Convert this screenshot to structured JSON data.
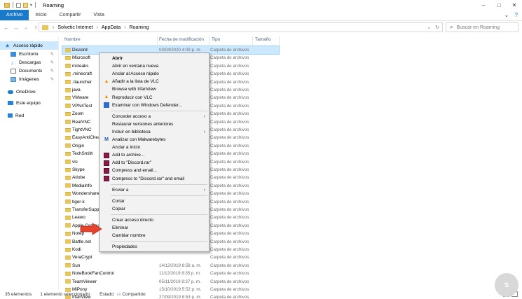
{
  "window": {
    "title": "Roaming",
    "controls": [
      "–",
      "□",
      "✕"
    ]
  },
  "ribbon": {
    "tabs": [
      "Archivo",
      "Inicio",
      "Compartir",
      "Vista"
    ],
    "expand": "⌄",
    "help": "?"
  },
  "address": {
    "segments": [
      "Solvetic Internet",
      "AppData",
      "Roaming"
    ],
    "search_placeholder": "Buscar en Roaming"
  },
  "nav": {
    "items": [
      {
        "label": "Acceso rápido",
        "icon": "star-icon",
        "selected": true,
        "pinned": false
      },
      {
        "label": "Escritorio",
        "icon": "desktop-icon",
        "selected": false,
        "pinned": true
      },
      {
        "label": "Descargas",
        "icon": "download-icon",
        "selected": false,
        "pinned": true
      },
      {
        "label": "Documents",
        "icon": "document-icon",
        "selected": false,
        "pinned": true
      },
      {
        "label": "Imágenes",
        "icon": "pictures-icon",
        "selected": false,
        "pinned": true
      },
      {
        "label": "OneDrive",
        "icon": "cloud-icon",
        "selected": false,
        "pinned": false
      },
      {
        "label": "Este equipo",
        "icon": "computer-icon",
        "selected": false,
        "pinned": false
      },
      {
        "label": "Red",
        "icon": "network-icon",
        "selected": false,
        "pinned": false
      }
    ]
  },
  "columns": {
    "name": "Nombre",
    "date": "Fecha de modificación",
    "type": "Tipo",
    "size": "Tamaño"
  },
  "files": [
    {
      "name": "Discord",
      "date": "03/04/2020 4:09 p. m.",
      "type": "Carpeta de archivos",
      "selected": true
    },
    {
      "name": "Microsoft",
      "date": "",
      "type": "Carpeta de archivos"
    },
    {
      "name": "mcleaks",
      "date": "",
      "type": "Carpeta de archivos"
    },
    {
      "name": ".minecraft",
      "date": "",
      "type": "Carpeta de archivos"
    },
    {
      "name": ".tlauncher",
      "date": "",
      "type": "Carpeta de archivos"
    },
    {
      "name": "java",
      "date": "",
      "type": "Carpeta de archivos"
    },
    {
      "name": "VMware",
      "date": "",
      "type": "Carpeta de archivos"
    },
    {
      "name": "VPN4Test",
      "date": "",
      "type": "Carpeta de archivos"
    },
    {
      "name": "Zoom",
      "date": "",
      "type": "Carpeta de archivos"
    },
    {
      "name": "RealVNC",
      "date": "",
      "type": "Carpeta de archivos"
    },
    {
      "name": "TightVNC",
      "date": "",
      "type": "Carpeta de archivos"
    },
    {
      "name": "EasyAntiCheat",
      "date": "",
      "type": "Carpeta de archivos"
    },
    {
      "name": "Origin",
      "date": "",
      "type": "Carpeta de archivos"
    },
    {
      "name": "TechSmith",
      "date": "",
      "type": "Carpeta de archivos"
    },
    {
      "name": "vlc",
      "date": "",
      "type": "Carpeta de archivos"
    },
    {
      "name": "Skype",
      "date": "",
      "type": "Carpeta de archivos"
    },
    {
      "name": "Adobe",
      "date": "",
      "type": "Carpeta de archivos"
    },
    {
      "name": "MediaInfo",
      "date": "",
      "type": "Carpeta de archivos"
    },
    {
      "name": "Wondershare",
      "date": "",
      "type": "Carpeta de archivos"
    },
    {
      "name": "tiger-k",
      "date": "",
      "type": "Carpeta de archivos"
    },
    {
      "name": "TransferSuppo",
      "date": "",
      "type": "Carpeta de archivos"
    },
    {
      "name": "Leawo",
      "date": "",
      "type": "Carpeta de archivos"
    },
    {
      "name": "Apple Compu",
      "date": "",
      "type": "Carpeta de archivos"
    },
    {
      "name": "Notep",
      "date": "",
      "type": "Carpeta de archivos"
    },
    {
      "name": "Battle.net",
      "date": "",
      "type": "Carpeta de archivos"
    },
    {
      "name": "Kodi",
      "date": "",
      "type": "Carpeta de archivos"
    },
    {
      "name": "VeraCrypt",
      "date": "",
      "type": "Carpeta de archivos"
    },
    {
      "name": "Sun",
      "date": "14/12/2019 8:58 a. m.",
      "type": "Carpeta de archivos"
    },
    {
      "name": "NoteBookFanControl",
      "date": "11/12/2019 8:35 p. m.",
      "type": "Carpeta de archivos"
    },
    {
      "name": "TeamViewer",
      "date": "05/11/2019 8:37 p. m.",
      "type": "Carpeta de archivos"
    },
    {
      "name": "MiPony",
      "date": "15/10/2019 5:52 p. m.",
      "type": "Carpeta de archivos"
    },
    {
      "name": "IrfanView",
      "date": "27/09/2019 8:53 p. m.",
      "type": "Carpeta de archivos"
    }
  ],
  "menu": [
    {
      "label": "Abrir",
      "bold": true,
      "icon": "",
      "sub": false,
      "sep_after": false
    },
    {
      "label": "Abrir en ventana nueva",
      "icon": "",
      "sub": false
    },
    {
      "label": "Anclar al Acceso rápido",
      "icon": "",
      "sub": false
    },
    {
      "label": "Añadir a la lista de VLC",
      "icon": "vlc-icon",
      "sub": false
    },
    {
      "label": "Browse with IrfanView",
      "icon": "",
      "sub": false
    },
    {
      "label": "Reproducir con VLC",
      "icon": "vlc-icon",
      "sub": false
    },
    {
      "label": "Examinar con Windows Defender...",
      "icon": "defender-icon",
      "sub": false,
      "sep_after": true
    },
    {
      "label": "Conceder acceso a",
      "icon": "",
      "sub": true
    },
    {
      "label": "Restaurar versiones anteriores",
      "icon": "",
      "sub": false
    },
    {
      "label": "Incluir en biblioteca",
      "icon": "",
      "sub": true
    },
    {
      "label": "Analizar con Malwarebytes",
      "icon": "malwarebytes-icon",
      "sub": false
    },
    {
      "label": "Anclar a Inicio",
      "icon": "",
      "sub": false
    },
    {
      "label": "Add to archive...",
      "icon": "winrar-icon",
      "sub": false
    },
    {
      "label": "Add to \"Discord.rar\"",
      "icon": "winrar-icon",
      "sub": false
    },
    {
      "label": "Compress and email...",
      "icon": "winrar-icon",
      "sub": false
    },
    {
      "label": "Compress to \"Discord.rar\" and email",
      "icon": "winrar-icon",
      "sub": false,
      "sep_after": true
    },
    {
      "label": "Enviar a",
      "icon": "",
      "sub": true,
      "sep_after": true
    },
    {
      "label": "Cortar",
      "icon": "",
      "sub": false
    },
    {
      "label": "Copiar",
      "icon": "",
      "sub": false,
      "sep_after": true
    },
    {
      "label": "Crear acceso directo",
      "icon": "",
      "sub": false
    },
    {
      "label": "Eliminar",
      "icon": "",
      "sub": false
    },
    {
      "label": "Cambiar nombre",
      "icon": "",
      "sub": false,
      "sep_after": true
    },
    {
      "label": "Propiedades",
      "icon": "",
      "sub": false
    }
  ],
  "status": {
    "count": "35 elementos",
    "selected": "1 elemento seleccionado",
    "state_label": "Estado:",
    "state_value": "Compartido"
  },
  "watermark": "S",
  "colors": {
    "accent": "#1979ca",
    "selection": "#cce8ff",
    "folder": "#e8c65a",
    "arrow": "#e8432f"
  }
}
